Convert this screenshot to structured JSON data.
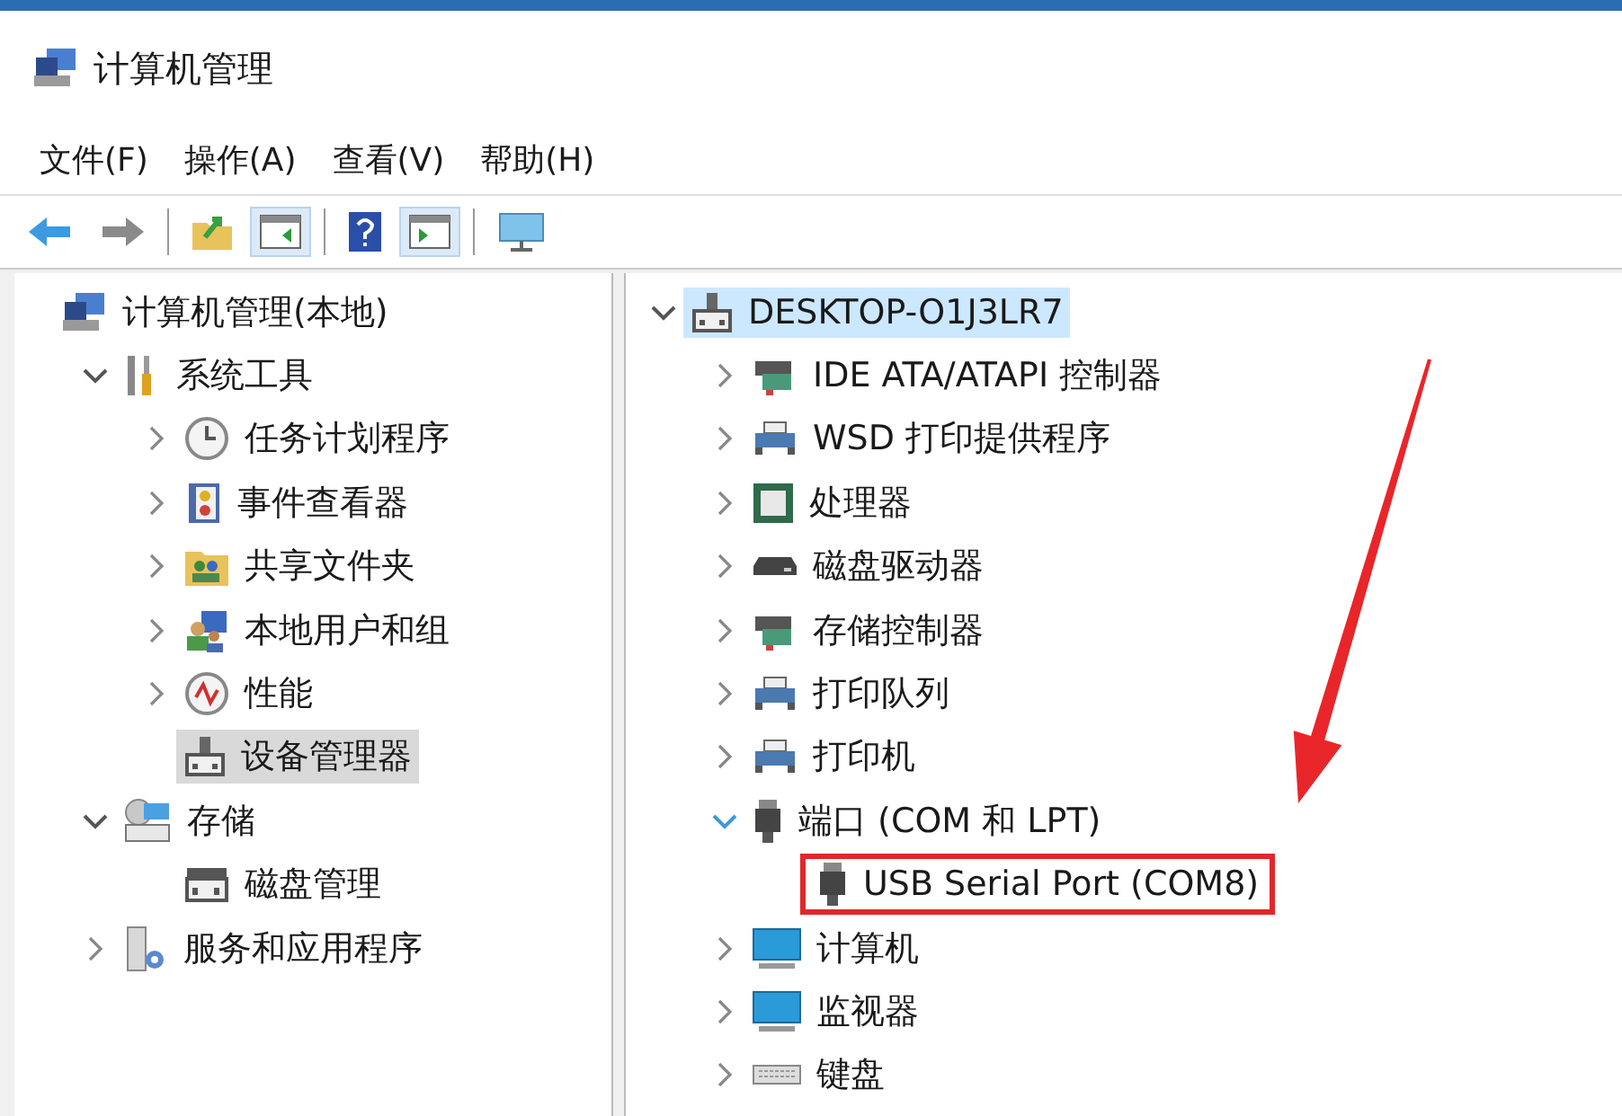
{
  "window": {
    "title": "计算机管理"
  },
  "menu": [
    "文件(F)",
    "操作(A)",
    "查看(V)",
    "帮助(H)"
  ],
  "toolbar": [
    {
      "kind": "back",
      "pressed": false
    },
    {
      "kind": "forward",
      "pressed": false
    },
    {
      "kind": "separator"
    },
    {
      "kind": "folder",
      "pressed": false
    },
    {
      "kind": "pane",
      "pressed": true
    },
    {
      "kind": "separator"
    },
    {
      "kind": "help",
      "pressed": false
    },
    {
      "kind": "panel",
      "pressed": true
    },
    {
      "kind": "separator"
    },
    {
      "kind": "screen",
      "pressed": false
    }
  ],
  "left_tree": [
    {
      "label": "计算机管理(本地)",
      "kind": "computer",
      "selected": false,
      "children": [
        {
          "label": "系统工具",
          "kind": "tools",
          "expanded": true,
          "selected": false,
          "children": [
            {
              "label": "任务计划程序",
              "kind": "clock",
              "expanded": false,
              "selected": false
            },
            {
              "label": "事件查看器",
              "kind": "log",
              "expanded": false,
              "selected": false
            },
            {
              "label": "共享文件夹",
              "kind": "shared",
              "expanded": false,
              "selected": false
            },
            {
              "label": "本地用户和组",
              "kind": "users",
              "expanded": false,
              "selected": false
            },
            {
              "label": "性能",
              "kind": "gauge",
              "expanded": false,
              "selected": false
            },
            {
              "label": "设备管理器",
              "kind": "device",
              "selected": true
            }
          ]
        },
        {
          "label": "存储",
          "kind": "storage",
          "expanded": true,
          "selected": false,
          "children": [
            {
              "label": "磁盘管理",
              "kind": "disk",
              "selected": false
            }
          ]
        },
        {
          "label": "服务和应用程序",
          "kind": "services",
          "expanded": false,
          "selected": false
        }
      ]
    }
  ],
  "right_tree": [
    {
      "label": "DESKTOP-O1J3LR7",
      "kind": "device",
      "expanded": true,
      "selected": true,
      "children": [
        {
          "label": "IDE ATA/ATAPI 控制器",
          "kind": "controller",
          "expanded": false,
          "selected": false
        },
        {
          "label": "WSD 打印提供程序",
          "kind": "printer",
          "expanded": false,
          "selected": false
        },
        {
          "label": "处理器",
          "kind": "chip",
          "expanded": false,
          "selected": false
        },
        {
          "label": "磁盘驱动器",
          "kind": "drive",
          "expanded": false,
          "selected": false
        },
        {
          "label": "存储控制器",
          "kind": "controller",
          "expanded": false,
          "selected": false
        },
        {
          "label": "打印队列",
          "kind": "printer",
          "expanded": false,
          "selected": false
        },
        {
          "label": "打印机",
          "kind": "printer",
          "expanded": false,
          "selected": false
        },
        {
          "label": "端口 (COM 和 LPT)",
          "kind": "plug",
          "expanded": true,
          "selected": false,
          "children": [
            {
              "label": "USB Serial Port (COM8)",
              "kind": "plug",
              "selected": false,
              "highlighted": true
            }
          ]
        },
        {
          "label": "计算机",
          "kind": "monitor",
          "expanded": false,
          "selected": false
        },
        {
          "label": "监视器",
          "kind": "monitor",
          "expanded": false,
          "selected": false
        },
        {
          "label": "键盘",
          "kind": "keyboard",
          "expanded": false,
          "selected": false
        }
      ]
    }
  ],
  "annotation_arrow": true
}
